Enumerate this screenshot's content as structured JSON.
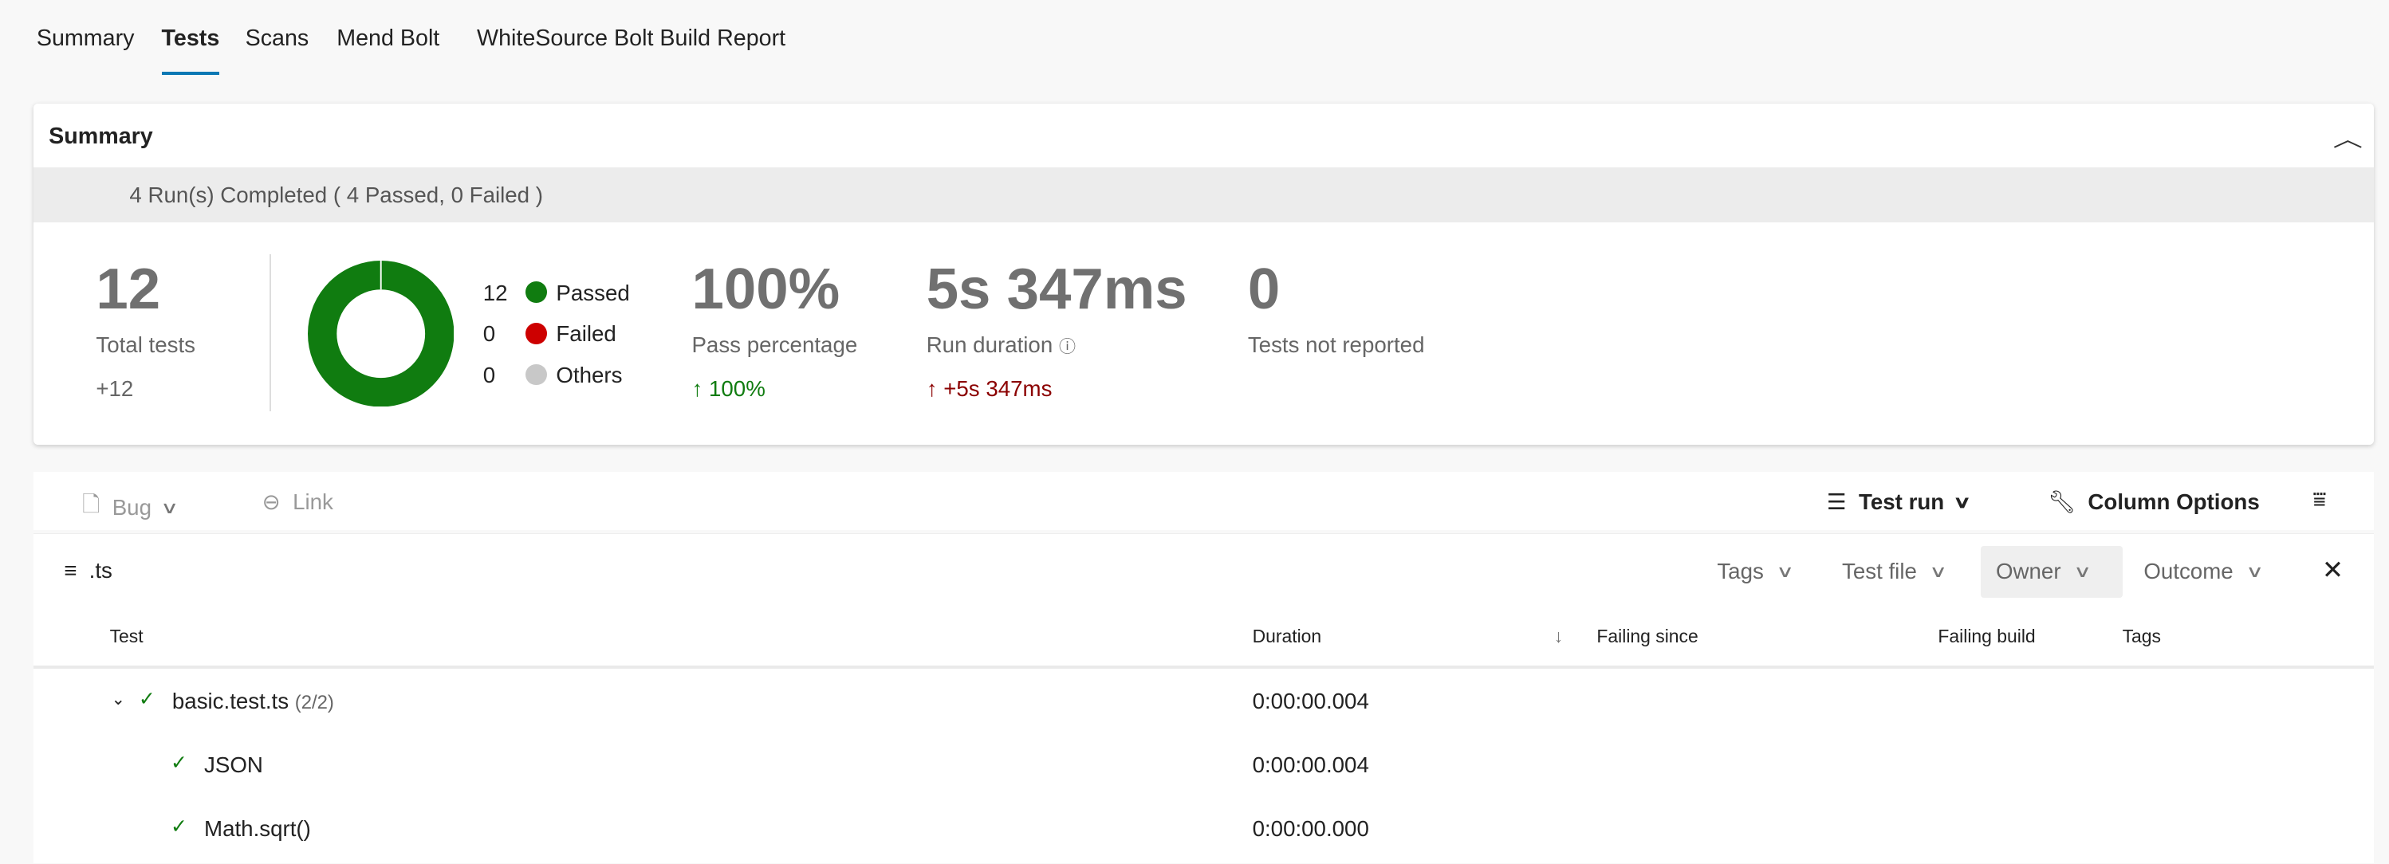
{
  "tabs": [
    {
      "label": "Summary"
    },
    {
      "label": "Tests",
      "active": true
    },
    {
      "label": "Scans"
    },
    {
      "label": "Mend Bolt"
    },
    {
      "label": "WhiteSource Bolt Build Report"
    }
  ],
  "summary": {
    "title": "Summary",
    "runs_status": "4 Run(s) Completed ( 4 Passed, 0 Failed )",
    "total_tests": {
      "value": "12",
      "label": "Total tests",
      "delta": "+12"
    },
    "donut": {
      "passed": 12,
      "failed": 0,
      "others": 0
    },
    "legend": [
      {
        "count": "12",
        "label": "Passed",
        "color": "#107c10"
      },
      {
        "count": "0",
        "label": "Failed",
        "color": "#cd0000"
      },
      {
        "count": "0",
        "label": "Others",
        "color": "#c8c8c8"
      }
    ],
    "pass_percentage": {
      "value": "100%",
      "label": "Pass percentage",
      "delta": "100%",
      "delta_color": "#107c10"
    },
    "run_duration": {
      "value": "5s 347ms",
      "label": "Run duration",
      "delta": "+5s 347ms",
      "delta_color": "#8b0000"
    },
    "not_reported": {
      "value": "0",
      "label": "Tests not reported"
    }
  },
  "toolbar": {
    "bug": "Bug",
    "link": "Link",
    "test_run": "Test run",
    "column_options": "Column Options"
  },
  "filter": {
    "text": ".ts",
    "chips": [
      "Tags",
      "Test file",
      "Owner",
      "Outcome"
    ]
  },
  "table": {
    "columns": [
      "Test",
      "Duration",
      "Failing since",
      "Failing build",
      "Tags"
    ],
    "group": {
      "name": "basic.test.ts",
      "count": "(2/2)",
      "duration": "0:00:00.004"
    },
    "rows": [
      {
        "name": "JSON",
        "duration": "0:00:00.004"
      },
      {
        "name": "Math.sqrt()",
        "duration": "0:00:00.000"
      }
    ]
  },
  "colors": {
    "accent": "#0a78b4",
    "passed": "#107c10",
    "failed": "#cd0000"
  }
}
